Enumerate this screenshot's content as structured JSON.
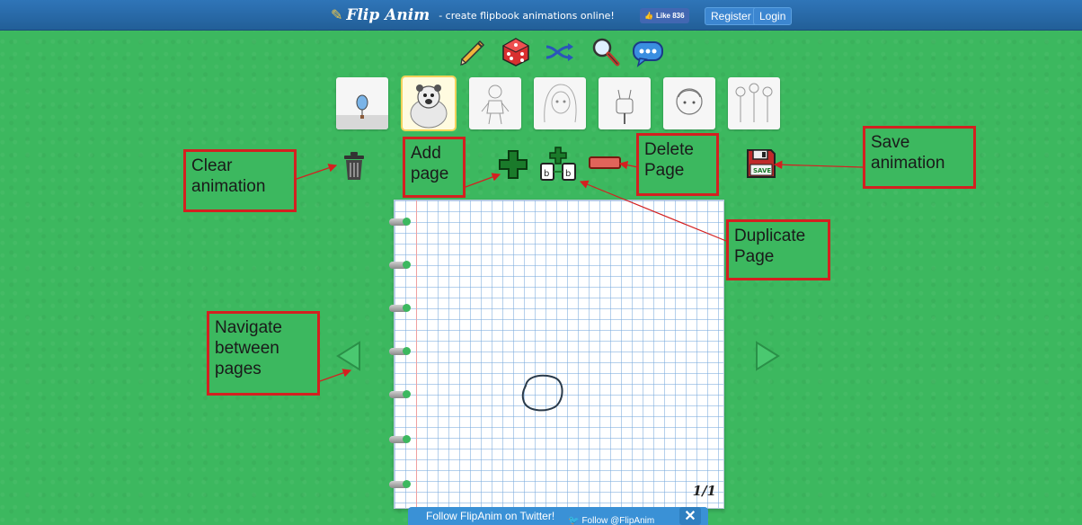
{
  "header": {
    "app_name": "Flip Anim",
    "tagline": "- create flipbook animations online!",
    "like_label": "Like 836",
    "register_label": "Register",
    "login_label": "Login"
  },
  "tools": [
    "pencil-icon",
    "dice-icon",
    "shuffle-icon",
    "search-icon",
    "chat-icon"
  ],
  "notebook": {
    "page_counter": "1/1"
  },
  "annotations": {
    "clear": "Clear animation",
    "add": "Add page",
    "delete": "Delete Page",
    "save": "Save animation",
    "duplicate": "Duplicate Page",
    "navigate": "Navigate between pages"
  },
  "twitter": {
    "message": "Follow FlipAnim on Twitter!",
    "follow_label": "Follow @FlipAnim",
    "close_label": "✕"
  },
  "colors": {
    "background": "#3cb85f",
    "header": "#2a6aa8",
    "annotation_border": "#d42020"
  }
}
